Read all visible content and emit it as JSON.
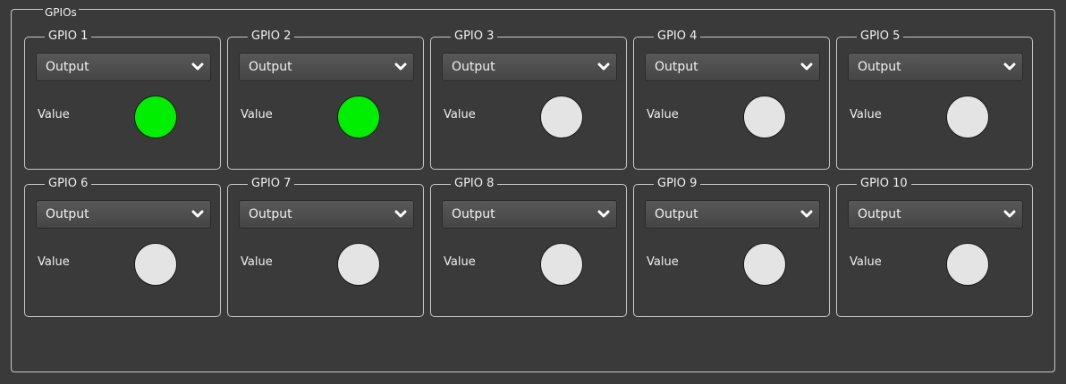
{
  "panel": {
    "title": "GPIOs"
  },
  "colors": {
    "on": "#00ee00",
    "off": "#e4e4e4"
  },
  "gpios": [
    {
      "label": "GPIO 1",
      "mode": "Output",
      "value_label": "Value",
      "on": true
    },
    {
      "label": "GPIO 2",
      "mode": "Output",
      "value_label": "Value",
      "on": true
    },
    {
      "label": "GPIO 3",
      "mode": "Output",
      "value_label": "Value",
      "on": false
    },
    {
      "label": "GPIO 4",
      "mode": "Output",
      "value_label": "Value",
      "on": false
    },
    {
      "label": "GPIO 5",
      "mode": "Output",
      "value_label": "Value",
      "on": false
    },
    {
      "label": "GPIO 6",
      "mode": "Output",
      "value_label": "Value",
      "on": false
    },
    {
      "label": "GPIO 7",
      "mode": "Output",
      "value_label": "Value",
      "on": false
    },
    {
      "label": "GPIO 8",
      "mode": "Output",
      "value_label": "Value",
      "on": false
    },
    {
      "label": "GPIO 9",
      "mode": "Output",
      "value_label": "Value",
      "on": false
    },
    {
      "label": "GPIO 10",
      "mode": "Output",
      "value_label": "Value",
      "on": false
    }
  ]
}
